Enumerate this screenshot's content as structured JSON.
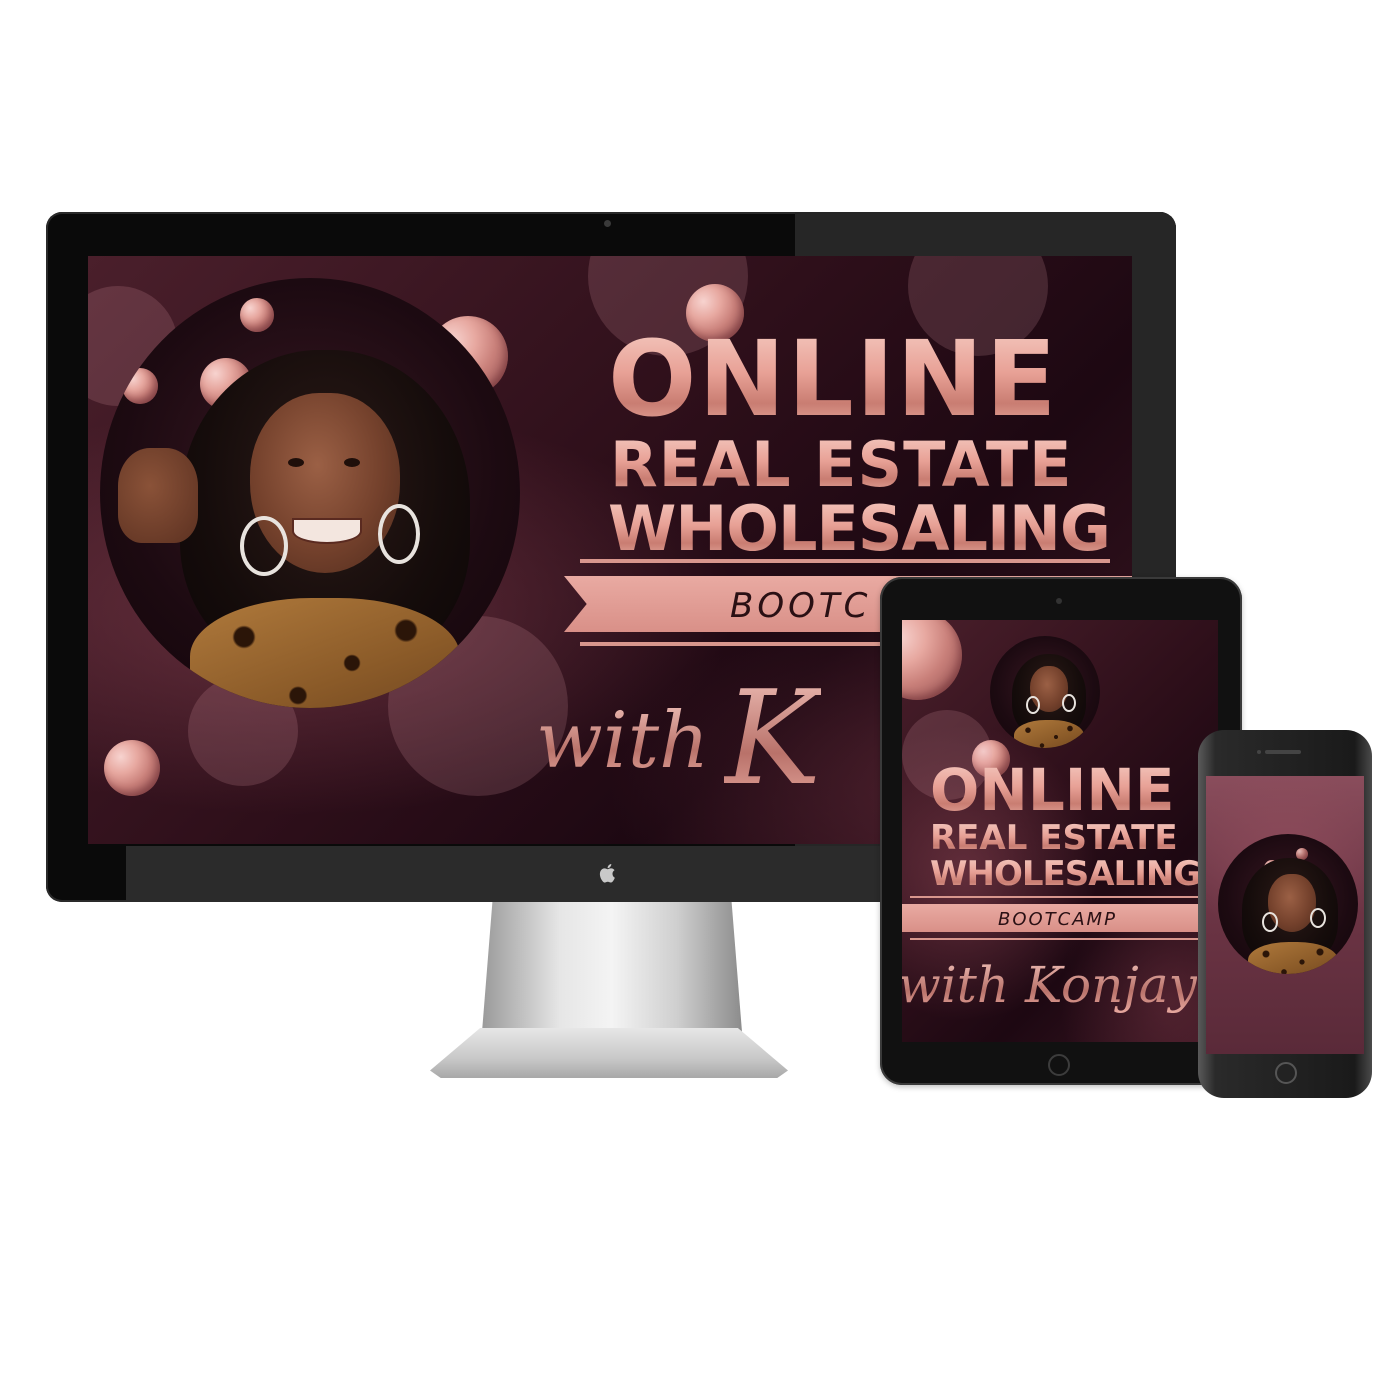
{
  "course": {
    "title_online": "ONLINE",
    "title_line2": "REAL ESTATE",
    "title_line3": "WHOLESALING",
    "banner_desktop": "BOOTC",
    "banner_full": "BOOTCAMP",
    "script_desktop_with": "with",
    "script_desktop_name": "K",
    "script_tablet": "with Konjay"
  },
  "devices": {
    "monitor_logo": "apple-icon",
    "tablet": "tablet",
    "phone": "phone"
  },
  "colors": {
    "accent_rose_gold": "#e8a196",
    "background_plum": "#2e0f1a",
    "banner_pink": "#e2a099"
  }
}
